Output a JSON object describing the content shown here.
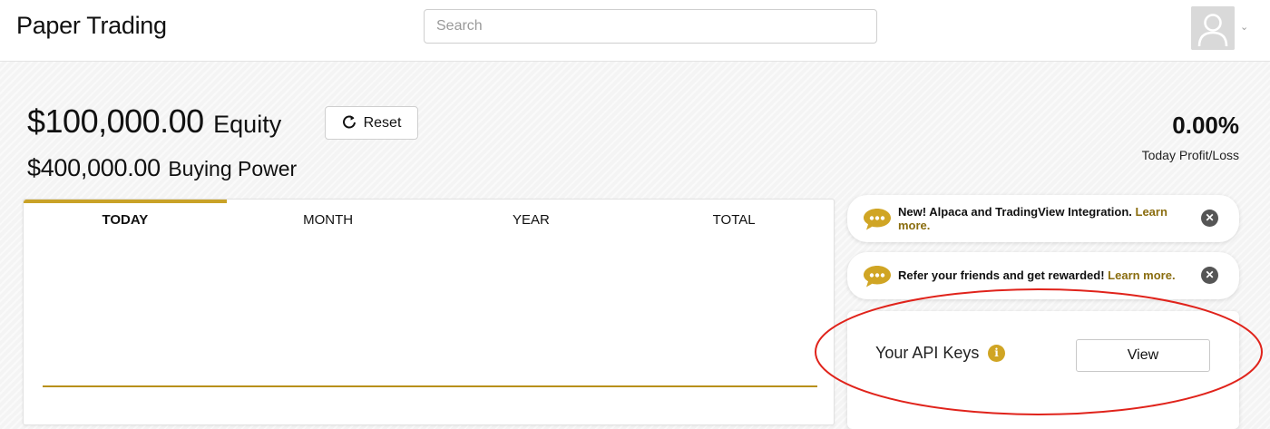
{
  "header": {
    "app_title": "Paper Trading",
    "search_placeholder": "Search",
    "search_value": "",
    "avatar_caret": "⌄"
  },
  "account": {
    "equity_value": "$100,000.00",
    "equity_label": "Equity",
    "reset_label": "Reset",
    "buying_power_value": "$400,000.00",
    "buying_power_label": "Buying Power",
    "profit_loss_value": "0.00%",
    "profit_loss_label": "Today Profit/Loss"
  },
  "chart_tabs": [
    {
      "label": "TODAY",
      "active": true
    },
    {
      "label": "MONTH",
      "active": false
    },
    {
      "label": "YEAR",
      "active": false
    },
    {
      "label": "TOTAL",
      "active": false
    }
  ],
  "banners": [
    {
      "text": "New! Alpaca and TradingView Integration. ",
      "link": "Learn more."
    },
    {
      "text": "Refer your friends and get rewarded! ",
      "link": "Learn more."
    }
  ],
  "api_keys": {
    "label": "Your API Keys",
    "info_icon": "i",
    "view_label": "View"
  },
  "colors": {
    "accent": "#c9a227",
    "chart_line": "#b8901a",
    "highlight": "#e0231b"
  },
  "icons": {
    "reset": "refresh-icon",
    "close": "close-icon",
    "chat": "chat-bubble-icon"
  }
}
